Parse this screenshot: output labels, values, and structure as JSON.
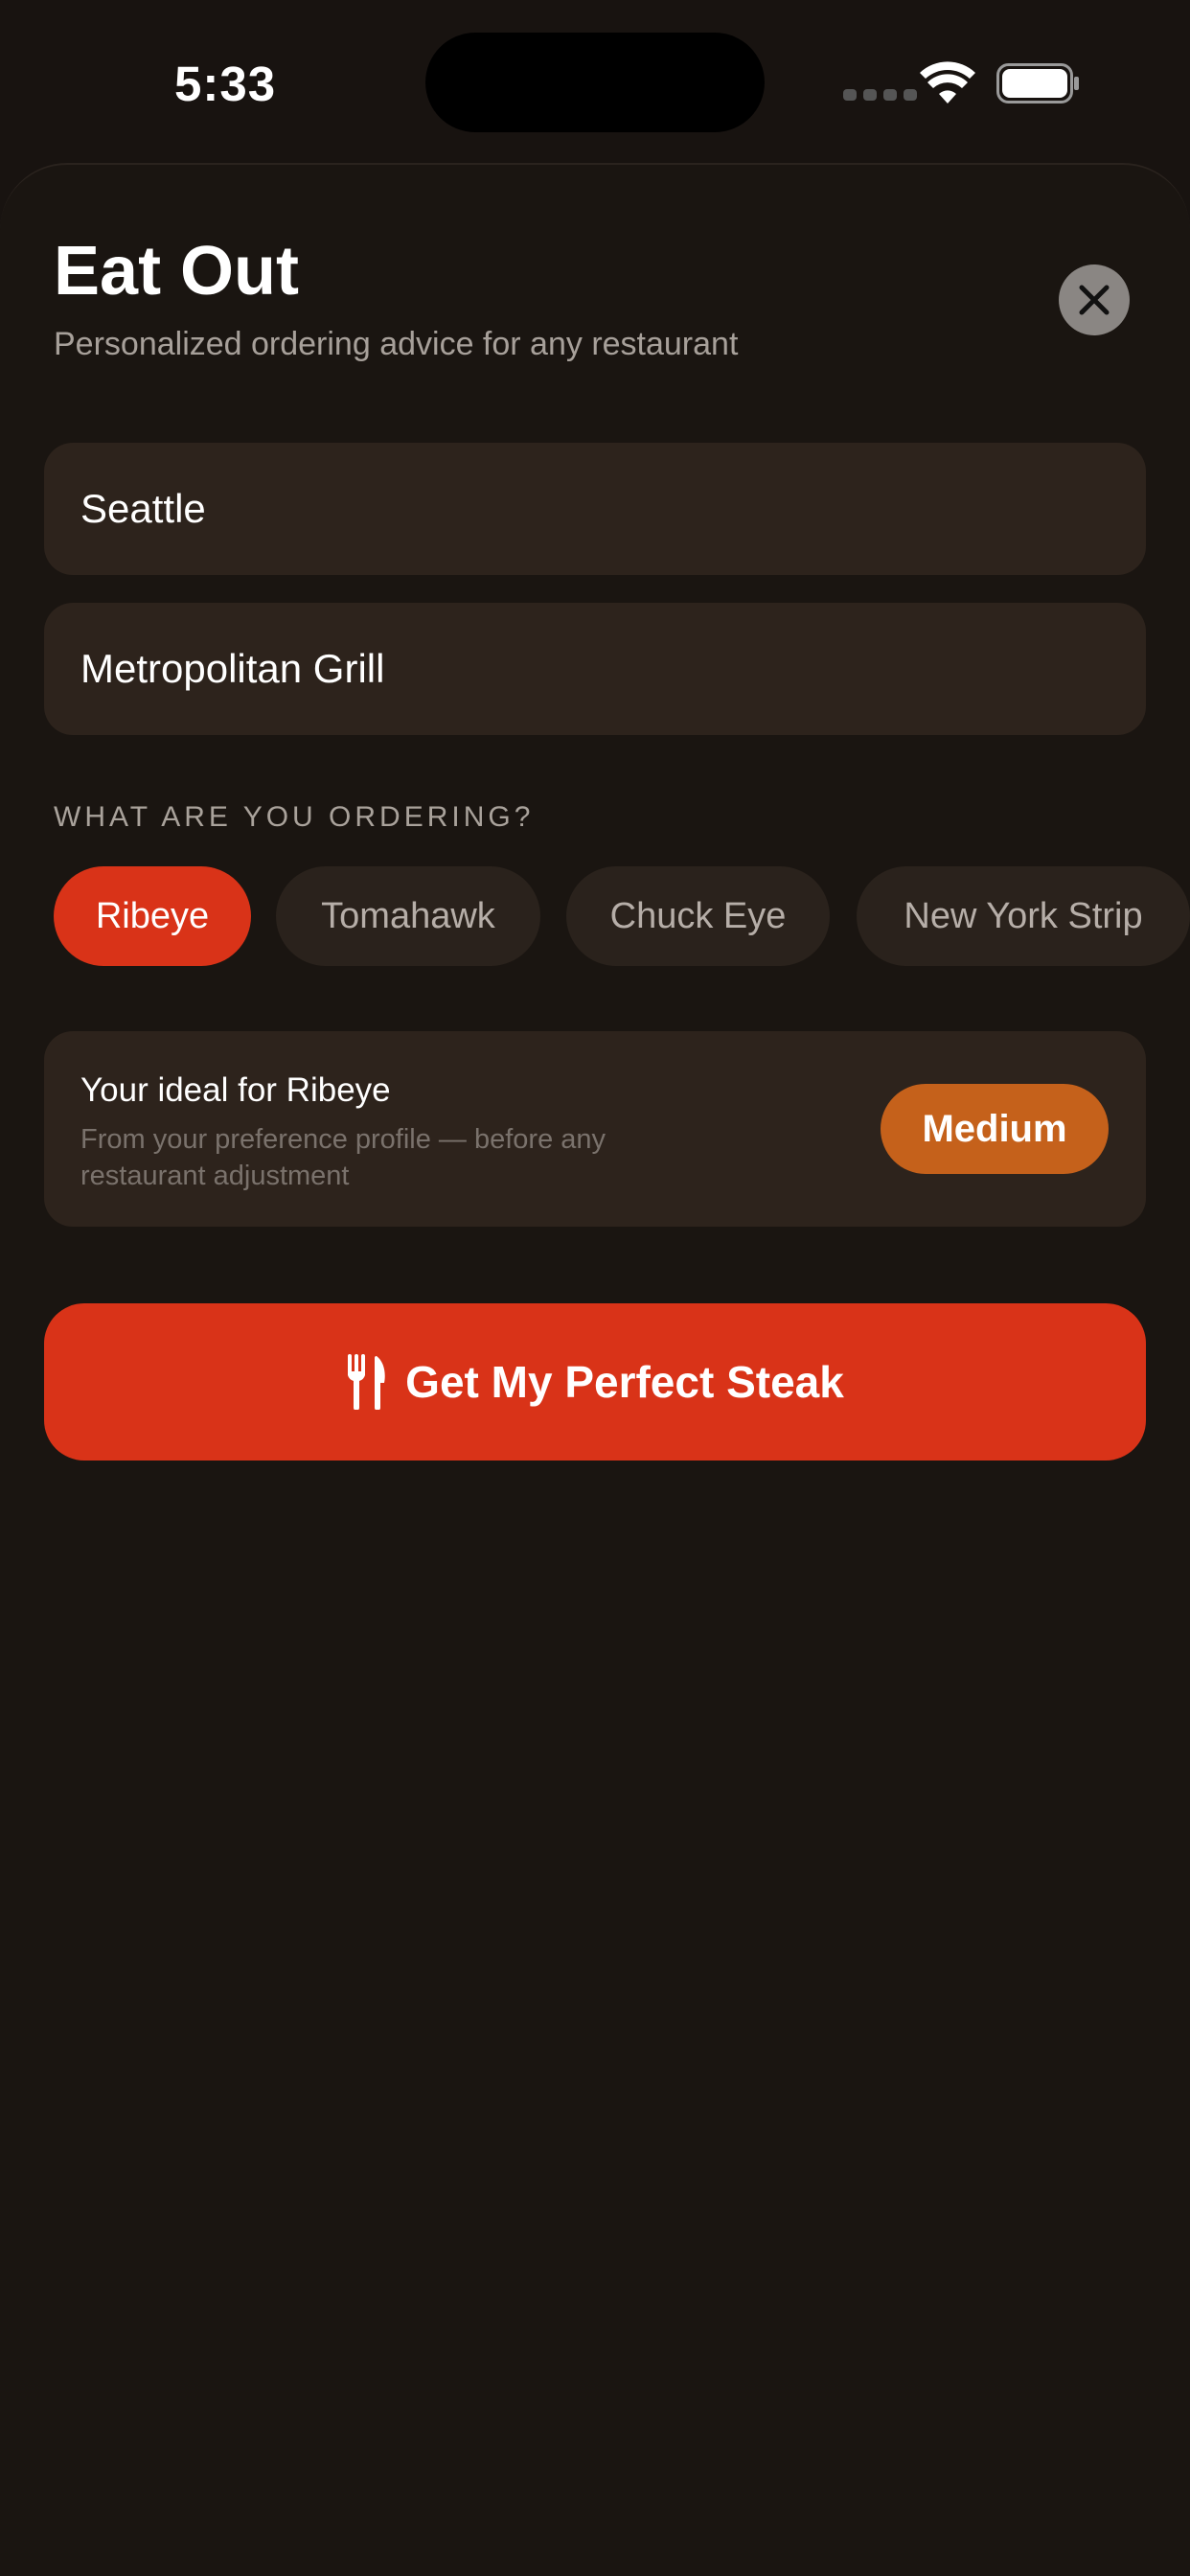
{
  "status_bar": {
    "time": "5:33"
  },
  "header": {
    "title": "Eat Out",
    "subtitle": "Personalized ordering advice for any restaurant",
    "close_icon": "close-icon"
  },
  "form": {
    "city_value": "Seattle",
    "restaurant_value": "Metropolitan Grill"
  },
  "ordering": {
    "label": "WHAT ARE YOU ORDERING?",
    "selected": "Ribeye",
    "options": [
      "Ribeye",
      "Tomahawk",
      "Chuck Eye",
      "New York Strip"
    ]
  },
  "ideal": {
    "title": "Your ideal for Ribeye",
    "description": "From your preference profile — before any restaurant adjustment",
    "doneness": "Medium"
  },
  "cta": {
    "label": "Get My Perfect Steak",
    "icon": "fork-knife-icon"
  },
  "colors": {
    "accent": "#d93318",
    "doneness": "#c5611b",
    "background": "#181310",
    "field": "#2d231c"
  }
}
